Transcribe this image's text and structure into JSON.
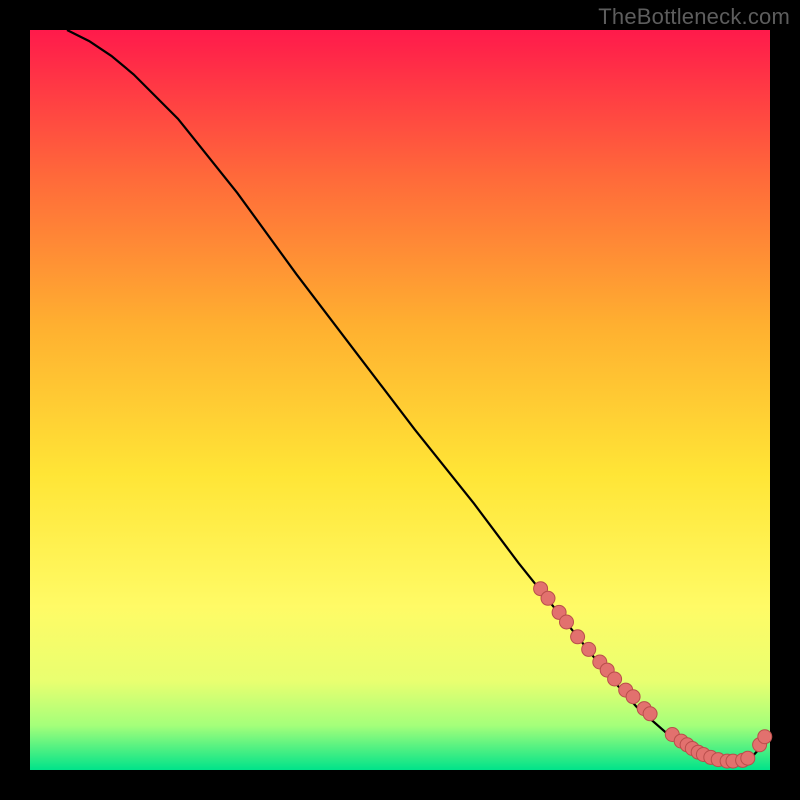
{
  "watermark": "TheBottleneck.com",
  "chart_data": {
    "type": "line",
    "title": "",
    "xlabel": "",
    "ylabel": "",
    "xlim": [
      0,
      100
    ],
    "ylim": [
      0,
      100
    ],
    "annotations": [],
    "gradient_colors": {
      "top": "#ff1a4b",
      "mid1": "#ff6a3a",
      "mid2": "#ffb030",
      "mid3": "#ffe536",
      "mid4": "#fffb66",
      "mid5": "#e9ff70",
      "mid6": "#a4ff7a",
      "bottom": "#00e38a"
    },
    "background_black_margin": {
      "left": 30,
      "right": 30,
      "bottom": 30
    },
    "series": [
      {
        "name": "bottleneck-curve",
        "stroke": "#000000",
        "x": [
          5,
          8,
          11,
          14,
          20,
          28,
          36,
          44,
          52,
          60,
          66,
          70,
          74,
          78,
          82,
          86,
          89,
          92,
          94,
          96,
          97.5,
          98.5,
          99.3
        ],
        "y": [
          100,
          98.5,
          96.5,
          94,
          88,
          78,
          67,
          56.5,
          46,
          36,
          28,
          23,
          18,
          13,
          8.5,
          5,
          3,
          1.8,
          1.2,
          1.2,
          1.7,
          2.8,
          4.5
        ]
      }
    ],
    "markers": {
      "name": "highlight-dots",
      "fill": "#e2716e",
      "stroke": "#b94e4b",
      "radius": 7,
      "x": [
        69,
        70,
        71.5,
        72.5,
        74,
        75.5,
        77,
        78,
        79,
        80.5,
        81.5,
        83,
        83.8,
        86.8,
        88,
        88.8,
        89.5,
        90.3,
        91.0,
        92.0,
        93.0,
        94.2,
        95.0,
        96.3,
        97.0,
        98.6,
        99.3
      ],
      "y": [
        24.5,
        23.2,
        21.3,
        20.0,
        18.0,
        16.3,
        14.6,
        13.5,
        12.3,
        10.8,
        9.9,
        8.3,
        7.6,
        4.8,
        3.9,
        3.4,
        2.9,
        2.4,
        2.1,
        1.7,
        1.4,
        1.2,
        1.2,
        1.3,
        1.6,
        3.4,
        4.5
      ]
    }
  }
}
